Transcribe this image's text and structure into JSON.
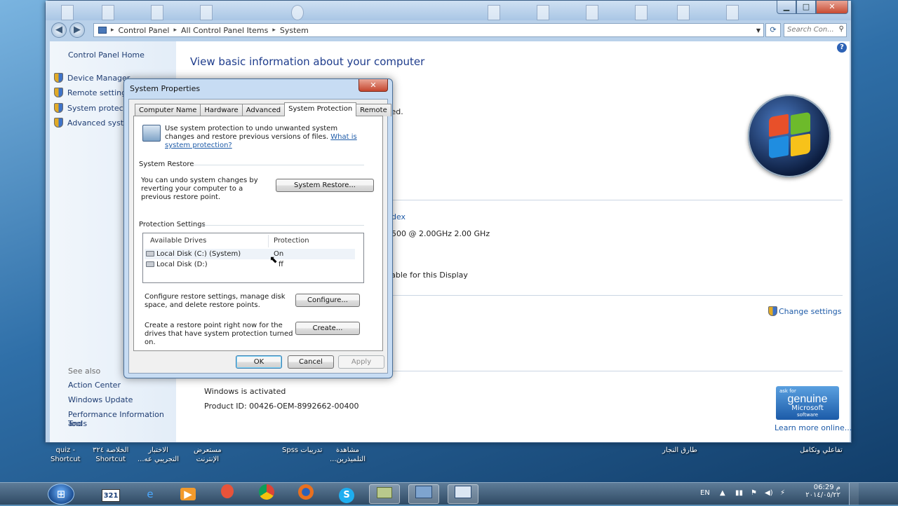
{
  "breadcrumb": [
    "Control Panel",
    "All Control Panel Items",
    "System"
  ],
  "search_placeholder": "Search Con...",
  "left_pane": {
    "home": "Control Panel Home",
    "tasks": [
      "Device Manager",
      "Remote settings",
      "System protectio",
      "Advanced systen"
    ],
    "see_also_title": "See also",
    "see_also": [
      "Action Center",
      "Windows Update",
      "Performance Information and",
      "Tools"
    ]
  },
  "content": {
    "heading": "View basic information about your computer",
    "fragment_reserved": "ved.",
    "fragment_index": "ndex",
    "fragment_cpu": "2500  @ 2.00GHz   2.00 GHz",
    "fragment_display": "ilable for this Display",
    "change_settings": "Change settings",
    "activation_status": "Windows is activated",
    "product_id": "Product ID: 00426-OEM-8992662-00400",
    "learn_more": "Learn more online...",
    "genuine": {
      "ask": "ask for",
      "word": "genuine",
      "ms": "Microsoft",
      "sw": "software"
    }
  },
  "dialog": {
    "title": "System Properties",
    "close": "✕",
    "tabs": [
      "Computer Name",
      "Hardware",
      "Advanced",
      "System Protection",
      "Remote"
    ],
    "active_tab": "System Protection",
    "intro": "Use system protection to undo unwanted system changes and restore previous versions of files.",
    "intro_link": "What is system protection?",
    "system_restore_title": "System Restore",
    "system_restore_text": "You can undo system changes by reverting your computer to a previous restore point.",
    "system_restore_btn": "System Restore...",
    "protection_title": "Protection Settings",
    "columns": [
      "Available Drives",
      "Protection"
    ],
    "drives": [
      {
        "name": "Local Disk (C:) (System)",
        "protection": "On"
      },
      {
        "name": "Local Disk (D:)",
        "protection": "ff"
      }
    ],
    "configure_text": "Configure restore settings, manage disk space, and delete restore points.",
    "configure_btn": "Configure...",
    "create_text": "Create a restore point right now for the drives that have system protection turned on.",
    "create_btn": "Create...",
    "ok": "OK",
    "cancel": "Cancel",
    "apply": "Apply"
  },
  "desktop_labels": [
    {
      "l1": "quiz -",
      "l2": "Shortcut"
    },
    {
      "l1": "الخلاصة ٣٢٤",
      "l2": "Shortcut"
    },
    {
      "l1": "الاختبار",
      "l2": "...التجريبي عه"
    },
    {
      "l1": "مستعرض",
      "l2": "الإنترنت"
    },
    {
      "l1": "Spss تدريبات",
      "l2": ""
    },
    {
      "l1": "مشاهدة",
      "l2": "...التلميذرين"
    },
    {
      "l1": "طارق النجار",
      "l2": ""
    },
    {
      "l1": "تفاعلي وتكامل",
      "l2": ""
    }
  ],
  "taskbar": {
    "lang": "EN",
    "time": "06:29 م",
    "date": "٢٠١٤/٠٥/٢٢",
    "apps": [
      "media-321-icon",
      "ie-icon",
      "media-player-icon",
      "app-icon",
      "chrome-icon",
      "firefox-icon",
      "skype-icon",
      "notes-icon",
      "control-panel-icon",
      "system-properties-icon"
    ]
  }
}
